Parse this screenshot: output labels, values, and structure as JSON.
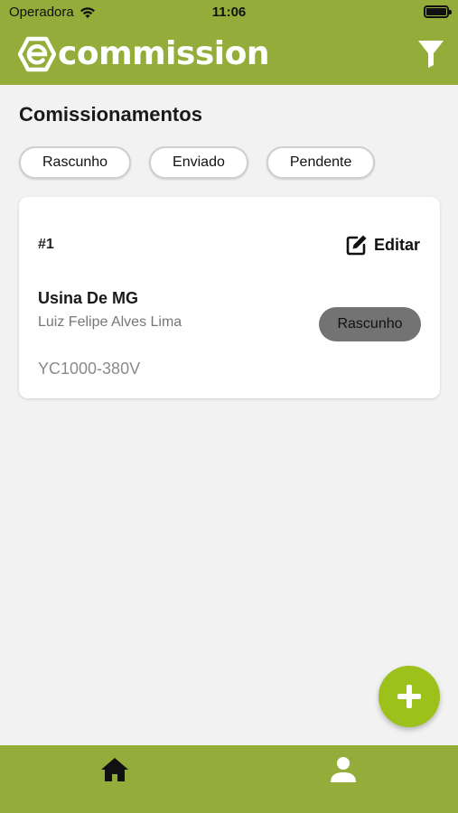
{
  "status_bar": {
    "carrier": "Operadora",
    "time": "11:06"
  },
  "header": {
    "logo_text": "commission",
    "logo_icon": "e-hexagon-logo",
    "filter_icon": "filter-icon"
  },
  "page": {
    "title": "Comissionamentos"
  },
  "filters": [
    {
      "label": "Rascunho"
    },
    {
      "label": "Enviado"
    },
    {
      "label": "Pendente"
    }
  ],
  "card": {
    "id": "#1",
    "edit_label": "Editar",
    "name": "Usina De MG",
    "person": "Luiz Felipe Alves Lima",
    "model": "YC1000-380V",
    "status": "Rascunho"
  },
  "colors": {
    "brand": "#94ad3a",
    "fab": "#9cc11a",
    "status_badge": "#737373"
  },
  "bottom_nav": {
    "items": [
      {
        "icon": "home-icon"
      },
      {
        "icon": "user-icon"
      }
    ]
  }
}
